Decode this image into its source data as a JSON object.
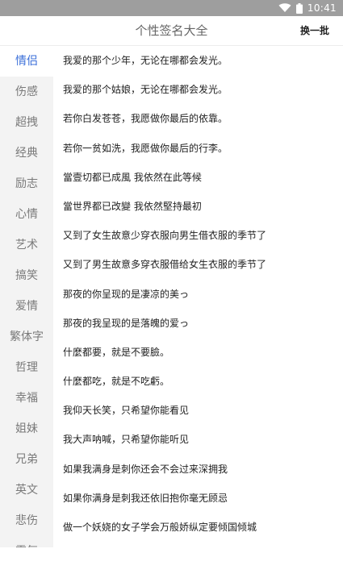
{
  "status_bar": {
    "time": "10:41"
  },
  "header": {
    "title": "个性签名大全",
    "action_label": "换一批"
  },
  "sidebar": {
    "items": [
      "情侣",
      "伤感",
      "超拽",
      "经典",
      "励志",
      "心情",
      "艺术",
      "搞笑",
      "爱情",
      "繁体字",
      "哲理",
      "幸福",
      "姐妹",
      "兄弟",
      "英文",
      "悲伤",
      "霸气"
    ],
    "active_index": 0
  },
  "content": {
    "signatures": [
      "我爱的那个少年，无论在哪都会发光。",
      "我爱的那个姑娘，无论在哪都会发光。",
      "若你白发苍苍，我愿做你最后的依靠。",
      "若你一贫如洗，我愿做你最后的行李。",
      "當壹切都已成風 我依然在此等候",
      "當世界都已改變 我依然堅持最初",
      "又到了女生故意少穿衣服向男生借衣服的季节了",
      "又到了男生故意多穿衣服借给女生衣服的季节了",
      "那夜的你呈现的是凄凉的美っ",
      "那夜的我呈现的是落魄的爱っ",
      "什麼都要，就是不要臉。",
      "什麼都吃，就是不吃虧。",
      "我仰天长笑，只希望你能看见",
      "我大声呐喊，只希望你能听见",
      "如果我满身是刺你还会不会过来深拥我",
      "如果你满身是刺我还依旧抱你毫无顾忌",
      "做一个妖娆的女子学会万般娇纵定要倾国倾城"
    ]
  },
  "colors": {
    "accent": "#3b6fd9",
    "status_bar": "#9e9e9e",
    "sidebar_bg": "#f3f3f3"
  },
  "icons": {
    "wifi": "wifi-icon",
    "battery": "battery-icon"
  }
}
